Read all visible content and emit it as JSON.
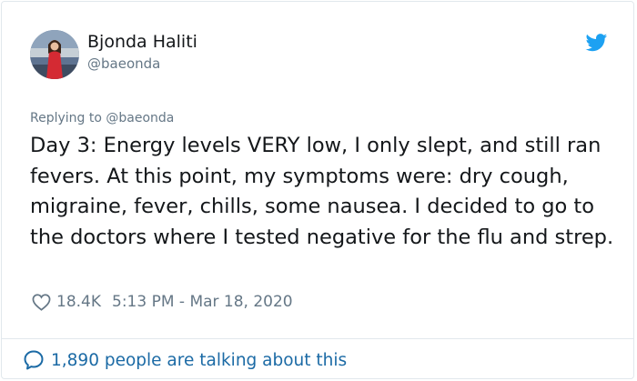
{
  "author": {
    "display_name": "Bjonda Haliti",
    "handle": "@baeonda",
    "avatar_icon": "profile-photo"
  },
  "reply_to": "Replying to @baeonda",
  "tweet": {
    "text": "Day 3: Energy levels VERY low, I only slept, and still ran fevers. At this point, my symptoms were: dry cough, migraine, fever, chills, some nausea. I decided to go to the doctors where I tested negative for the flu and strep."
  },
  "stats": {
    "likes": "18.4K",
    "timestamp": "5:13 PM - Mar 18, 2020"
  },
  "footer": {
    "talking": "1,890 people are talking about this"
  },
  "colors": {
    "twitter_blue": "#1da1f2",
    "link_blue": "#1b6aa5",
    "text": "#14171a",
    "muted": "#657786",
    "border": "#e1e8ed"
  },
  "icons": {
    "brand": "twitter-bird-icon",
    "like": "heart-icon",
    "conversation": "speech-bubble-icon"
  }
}
